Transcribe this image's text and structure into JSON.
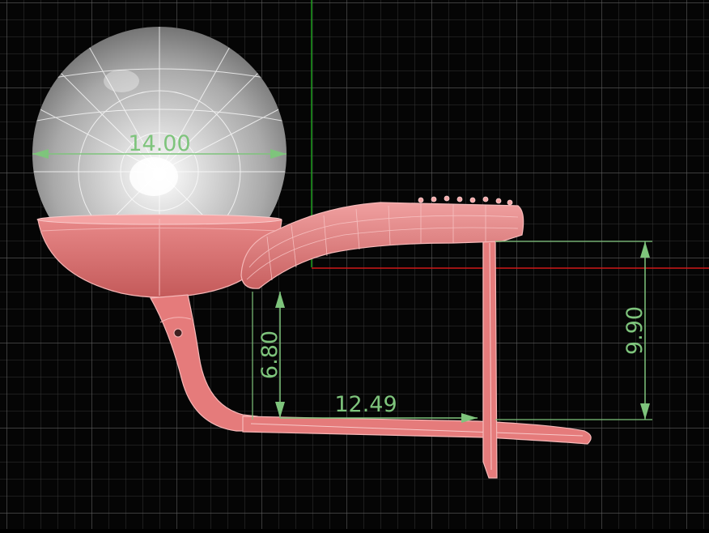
{
  "colors": {
    "background": "#050505",
    "grid_minor": "#3a3a3a",
    "grid_major": "#6a6a6a",
    "axis_x": "#d01818",
    "axis_y": "#1fa01f",
    "part": "#e57b7b",
    "part_shade": "#b85050",
    "wire": "#f6b8b8",
    "pearl": "#d8d8d8",
    "dimension": "#7ec47c"
  },
  "dimensions": {
    "pearl_diameter": "14.00",
    "post_height": "6.80",
    "lever_length": "12.49",
    "clip_height": "9.90"
  }
}
